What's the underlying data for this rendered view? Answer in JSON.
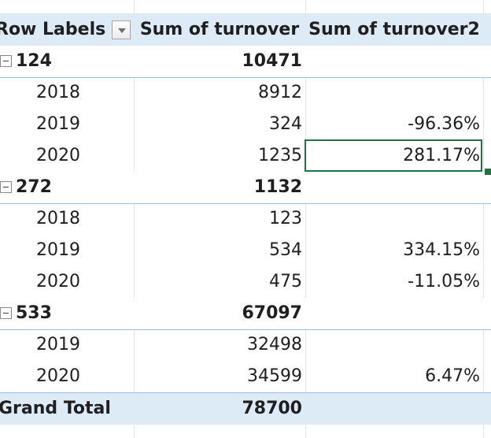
{
  "pivot": {
    "headers": {
      "row_labels": "Row Labels",
      "col2": "Sum of turnover",
      "col3": "Sum of turnover2"
    },
    "groups": [
      {
        "label": "124",
        "total": "10471",
        "rows": [
          {
            "year": "2018",
            "turnover": "8912",
            "turnover2": ""
          },
          {
            "year": "2019",
            "turnover": "324",
            "turnover2": "-96.36%"
          },
          {
            "year": "2020",
            "turnover": "1235",
            "turnover2": "281.17%"
          }
        ]
      },
      {
        "label": "272",
        "total": "1132",
        "rows": [
          {
            "year": "2018",
            "turnover": "123",
            "turnover2": ""
          },
          {
            "year": "2019",
            "turnover": "534",
            "turnover2": "334.15%"
          },
          {
            "year": "2020",
            "turnover": "475",
            "turnover2": "-11.05%"
          }
        ]
      },
      {
        "label": "533",
        "total": "67097",
        "rows": [
          {
            "year": "2019",
            "turnover": "32498",
            "turnover2": ""
          },
          {
            "year": "2020",
            "turnover": "34599",
            "turnover2": "6.47%"
          }
        ]
      }
    ],
    "grand_total": {
      "label": "Grand Total",
      "value": "78700"
    }
  },
  "colors": {
    "header_fill": "#ddebf7",
    "border_blue": "#9bc2e6",
    "selection_green": "#217346"
  },
  "icons": {
    "filter": "dropdown-filter-icon",
    "collapse": "collapse-minus-icon"
  }
}
